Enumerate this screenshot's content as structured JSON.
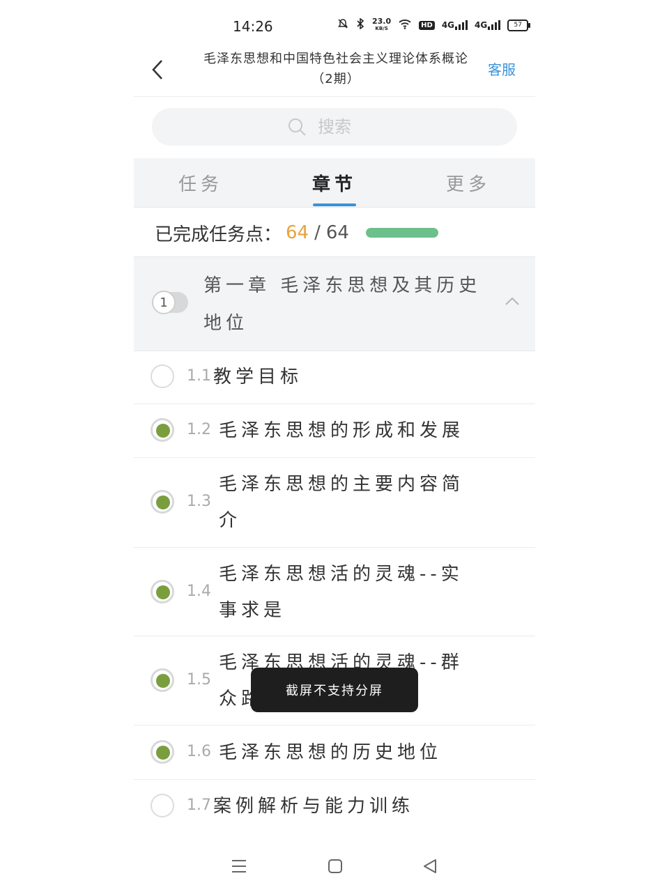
{
  "status_bar": {
    "time": "14:26",
    "net_speed": "23.0",
    "net_unit": "KB/S",
    "hd": "HD",
    "signal1": "4G",
    "signal2": "4G",
    "battery": "57"
  },
  "header": {
    "title": "毛泽东思想和中国特色社会主义理论体系概论（2期）",
    "service": "客服"
  },
  "search": {
    "placeholder": "搜索"
  },
  "tabs": [
    {
      "label": "任务",
      "active": false
    },
    {
      "label": "章节",
      "active": true
    },
    {
      "label": "更多",
      "active": false
    }
  ],
  "progress": {
    "label": "已完成任务点：",
    "done": "64",
    "separator": "/",
    "total": "64",
    "fraction": 1.0,
    "color": "#6cc08b"
  },
  "chapter": {
    "number": "1",
    "title": "第一章 毛泽东思想及其历史地位"
  },
  "lessons": [
    {
      "num": "1.1",
      "title": "教学目标",
      "checked": false
    },
    {
      "num": "1.2",
      "title": "毛泽东思想的形成和发展",
      "checked": true
    },
    {
      "num": "1.3",
      "title": "毛泽东思想的主要内容简介",
      "checked": true
    },
    {
      "num": "1.4",
      "title": "毛泽东思想活的灵魂--实事求是",
      "checked": true
    },
    {
      "num": "1.5",
      "title": "毛泽东思想活的灵魂--群众路线",
      "checked": true
    },
    {
      "num": "1.6",
      "title": "毛泽东思想的历史地位",
      "checked": true
    },
    {
      "num": "1.7",
      "title": "案例解析与能力训练",
      "checked": false
    }
  ],
  "toast": "截屏不支持分屏",
  "colors": {
    "accent": "#3a93d8",
    "done_number": "#e9a23b",
    "check": "#7a9e3e"
  }
}
